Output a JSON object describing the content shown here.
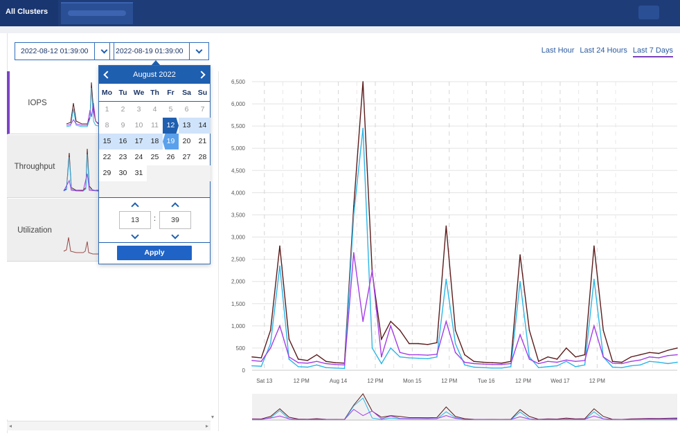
{
  "header": {
    "active_tab": "All Clusters View"
  },
  "date_range": {
    "start": "2022-08-12 01:39:00",
    "end": "2022-08-19 01:39:00"
  },
  "range_links": [
    {
      "label": "Last Hour",
      "active": false
    },
    {
      "label": "Last 24 Hours",
      "active": false
    },
    {
      "label": "Last 7 Days",
      "active": true
    }
  ],
  "metrics": [
    {
      "label": "IOPS",
      "selected": true
    },
    {
      "label": "Throughput",
      "selected": false
    },
    {
      "label": "Utilization",
      "selected": false
    }
  ],
  "calendar": {
    "month_label": "August 2022",
    "weekdays": [
      "Mo",
      "Tu",
      "We",
      "Th",
      "Fr",
      "Sa",
      "Su"
    ],
    "weeks": [
      [
        "1",
        "2",
        "3",
        "4",
        "5",
        "6",
        "7"
      ],
      [
        "8",
        "9",
        "10",
        "11",
        "12",
        "13",
        "14"
      ],
      [
        "15",
        "16",
        "17",
        "18",
        "19",
        "20",
        "21"
      ],
      [
        "22",
        "23",
        "24",
        "25",
        "26",
        "27",
        "28"
      ],
      [
        "29",
        "30",
        "31",
        "",
        "",
        "",
        ""
      ]
    ],
    "range_start": 12,
    "range_end": 19,
    "hour": "13",
    "minute": "39",
    "colon": ":",
    "apply_label": "Apply"
  },
  "colors": {
    "header_bg": "#1e3c78",
    "accent_blue": "#1f5fb0",
    "selected_purple": "#7b44c6",
    "series_dark_red": "#5a1a1a",
    "series_cyan": "#2bb5e6",
    "series_purple": "#a43ce6"
  },
  "chart_data": {
    "type": "line",
    "ylim": [
      0,
      6500
    ],
    "y_ticks": [
      "0",
      "500",
      "1,000",
      "1,500",
      "2,000",
      "2,500",
      "3,000",
      "3,500",
      "4,000",
      "4,500",
      "5,000",
      "5,500",
      "6,000",
      "6,500"
    ],
    "x_tick_labels": [
      "Sat 13",
      "12 PM",
      "Aug 14",
      "12 PM",
      "Mon 15",
      "12 PM",
      "Tue 16",
      "12 PM",
      "Wed 17",
      "12 PM"
    ],
    "x_hours": [
      0,
      3,
      6,
      9,
      12,
      15,
      18,
      21,
      24,
      27,
      30,
      33,
      36,
      39,
      42,
      45,
      48,
      51,
      54,
      57,
      60,
      63,
      66,
      69,
      72,
      75,
      78,
      81,
      84,
      87,
      90,
      93,
      96,
      99,
      102,
      105,
      108,
      111,
      114,
      117,
      120,
      123,
      126,
      129,
      132,
      135,
      138
    ],
    "series": [
      {
        "color": "#5a1a1a",
        "values": [
          300,
          280,
          900,
          2800,
          700,
          250,
          220,
          350,
          200,
          170,
          160,
          3700,
          6500,
          2200,
          700,
          1100,
          900,
          600,
          600,
          580,
          620,
          3250,
          900,
          350,
          200,
          180,
          170,
          160,
          200,
          2600,
          900,
          200,
          300,
          250,
          500,
          300,
          350,
          2800,
          900,
          200,
          180,
          300,
          350,
          400,
          380,
          450,
          500
        ]
      },
      {
        "color": "#2bb5e6",
        "values": [
          100,
          90,
          600,
          2350,
          250,
          80,
          70,
          120,
          60,
          50,
          40,
          3500,
          5450,
          500,
          150,
          500,
          300,
          280,
          270,
          260,
          300,
          2050,
          600,
          120,
          70,
          60,
          50,
          50,
          80,
          2000,
          300,
          60,
          80,
          100,
          200,
          80,
          120,
          2050,
          300,
          70,
          60,
          100,
          120,
          200,
          180,
          150,
          180
        ]
      },
      {
        "color": "#a43ce6",
        "values": [
          220,
          200,
          500,
          1000,
          300,
          170,
          160,
          200,
          150,
          130,
          120,
          2650,
          1100,
          2250,
          300,
          1000,
          400,
          350,
          350,
          340,
          360,
          1100,
          400,
          180,
          150,
          140,
          130,
          130,
          150,
          800,
          250,
          150,
          200,
          180,
          230,
          200,
          220,
          1000,
          300,
          160,
          150,
          200,
          230,
          300,
          280,
          330,
          350
        ]
      }
    ]
  }
}
